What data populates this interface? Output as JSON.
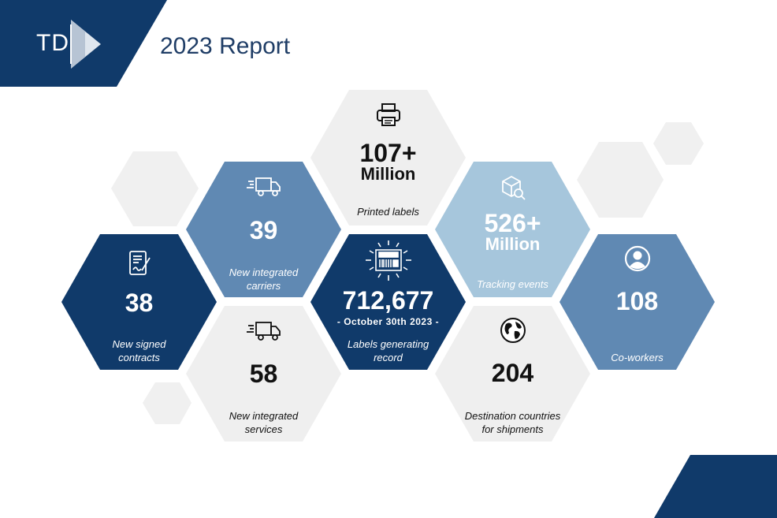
{
  "header": {
    "logo_text": "TD",
    "title": "2023 Report"
  },
  "colors": {
    "navy": "#103a6a",
    "steel": "#6089b3",
    "sky": "#a6c6dc",
    "pale": "#efefef"
  },
  "stats": {
    "printed_labels": {
      "value": "107+",
      "unit": "Million",
      "label": "Printed labels",
      "icon": "printer-icon"
    },
    "carriers": {
      "value": "39",
      "label_line1": "New integrated",
      "label_line2": "carriers",
      "icon": "delivery-truck-icon"
    },
    "tracking": {
      "value": "526+",
      "unit": "Million",
      "label": "Tracking events",
      "icon": "package-search-icon"
    },
    "contracts": {
      "value": "38",
      "label_line1": "New signed",
      "label_line2": "contracts",
      "icon": "signed-document-icon"
    },
    "record": {
      "value": "712,677",
      "date": "- October 30th 2023 -",
      "label_line1": "Labels generating",
      "label_line2": "record",
      "icon": "barcode-label-icon"
    },
    "coworkers": {
      "value": "108",
      "label": "Co-workers",
      "icon": "user-icon"
    },
    "services": {
      "value": "58",
      "label_line1": "New integrated",
      "label_line2": "services",
      "icon": "delivery-truck-icon"
    },
    "countries": {
      "value": "204",
      "label_line1": "Destination countries",
      "label_line2": "for shipments",
      "icon": "globe-icon"
    }
  }
}
